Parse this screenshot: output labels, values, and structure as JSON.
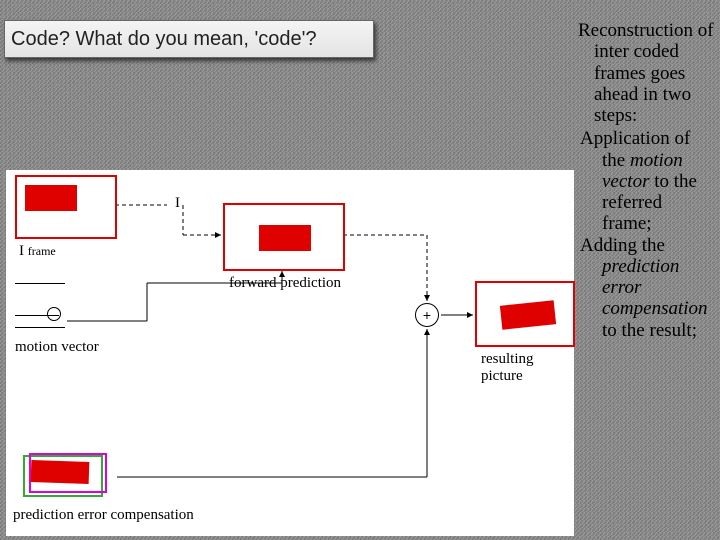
{
  "title": "Code? What do you mean, 'code'?",
  "right_text": {
    "l1": "Reconstruction of inter coded frames goes ahead in two steps:",
    "b1a": "Application of the ",
    "b1i": "motion vector",
    "b1b": " to the referred frame;",
    "b2a": "Adding the ",
    "b2i": "prediction error compensation",
    "b2b": " to the result;"
  },
  "labels": {
    "iframe_caption_a": "I  ",
    "iframe_caption_b": "frame",
    "motion_vector": "motion vector",
    "forward_prediction": "forward prediction",
    "resulting_picture": "resulting picture",
    "pec": "prediction error compensation",
    "plus": "+",
    "i_glyph": "I"
  },
  "diagram": {
    "nodes": [
      {
        "id": "iframe",
        "kind": "frame-box"
      },
      {
        "id": "fwd",
        "kind": "frame-box"
      },
      {
        "id": "result",
        "kind": "frame-box"
      },
      {
        "id": "pec",
        "kind": "pec-box"
      },
      {
        "id": "adder",
        "kind": "sum"
      }
    ],
    "edges": [
      [
        "iframe",
        "fwd"
      ],
      [
        "motion_vector",
        "fwd"
      ],
      [
        "fwd",
        "adder"
      ],
      [
        "pec",
        "adder"
      ],
      [
        "adder",
        "result"
      ]
    ]
  },
  "colors": {
    "accent": "#df0000",
    "pec_green": "#33aa33",
    "pec_mag": "#dd00dd"
  }
}
